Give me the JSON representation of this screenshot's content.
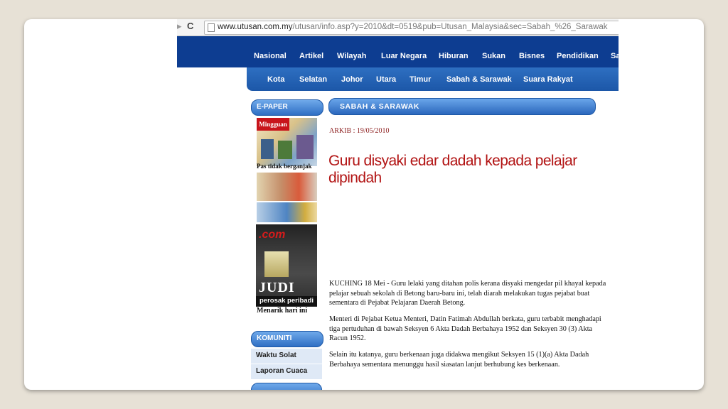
{
  "browser": {
    "url_domain": "www.utusan.com.my",
    "url_path": "/utusan/info.asp?y=2010&dt=0519&pub=Utusan_Malaysia&sec=Sabah_%26_Sarawak",
    "reload_glyph": "C"
  },
  "nav_primary": [
    "Nasional",
    "Artikel",
    "Wilayah",
    "Luar Negara",
    "Hiburan",
    "Sukan",
    "Bisnes",
    "Pendidikan",
    "Sa"
  ],
  "nav_secondary": [
    "Kota",
    "Selatan",
    "Johor",
    "Utara",
    "Timur",
    "Sabah & Sarawak",
    "Suara Rakyat"
  ],
  "sidebar": {
    "epaper_heading": "E-PAPER",
    "mingguan": "Mingguan",
    "pas_caption": "Pas tidak berganjak",
    "com_logo": ".com",
    "judi": "JUDI",
    "perosak": "perosak peribadi",
    "menarik": "Menarik hari ini",
    "komuniti_heading": "KOMUNITI",
    "komuniti_items": [
      "Waktu Solat",
      "Laporan Cuaca"
    ]
  },
  "article": {
    "section": "SABAH & SARAWAK",
    "arkib": "ARKIB : 19/05/2010",
    "headline": "Guru disyaki edar dadah kepada pelajar dipindah",
    "paragraphs": [
      "KUCHING 18 Mei - Guru lelaki yang ditahan polis kerana disyaki mengedar pil khayal kepada pelajar sebuah sekolah di Betong baru-baru ini, telah diarah melakukan tugas pejabat buat sementara di Pejabat Pelajaran Daerah Betong.",
      "Menteri di Pejabat Ketua Menteri, Datin Fatimah Abdullah berkata, guru terbabit menghadapi tiga pertuduhan di bawah Seksyen 6 Akta Dadah Berbahaya 1952 dan Seksyen 30 (3) Akta Racun 1952.",
      "Selain itu katanya, guru berkenaan juga didakwa mengikut Seksyen 15 (1)(a) Akta Dadah Berbahaya sementara menunggu hasil siasatan lanjut berhubung kes berkenaan."
    ]
  },
  "colors": {
    "nav_dark": "#0d3d91",
    "nav_light": "#2e6fc1",
    "headline": "#b21414",
    "slide_bg": "#e7e1d6"
  }
}
